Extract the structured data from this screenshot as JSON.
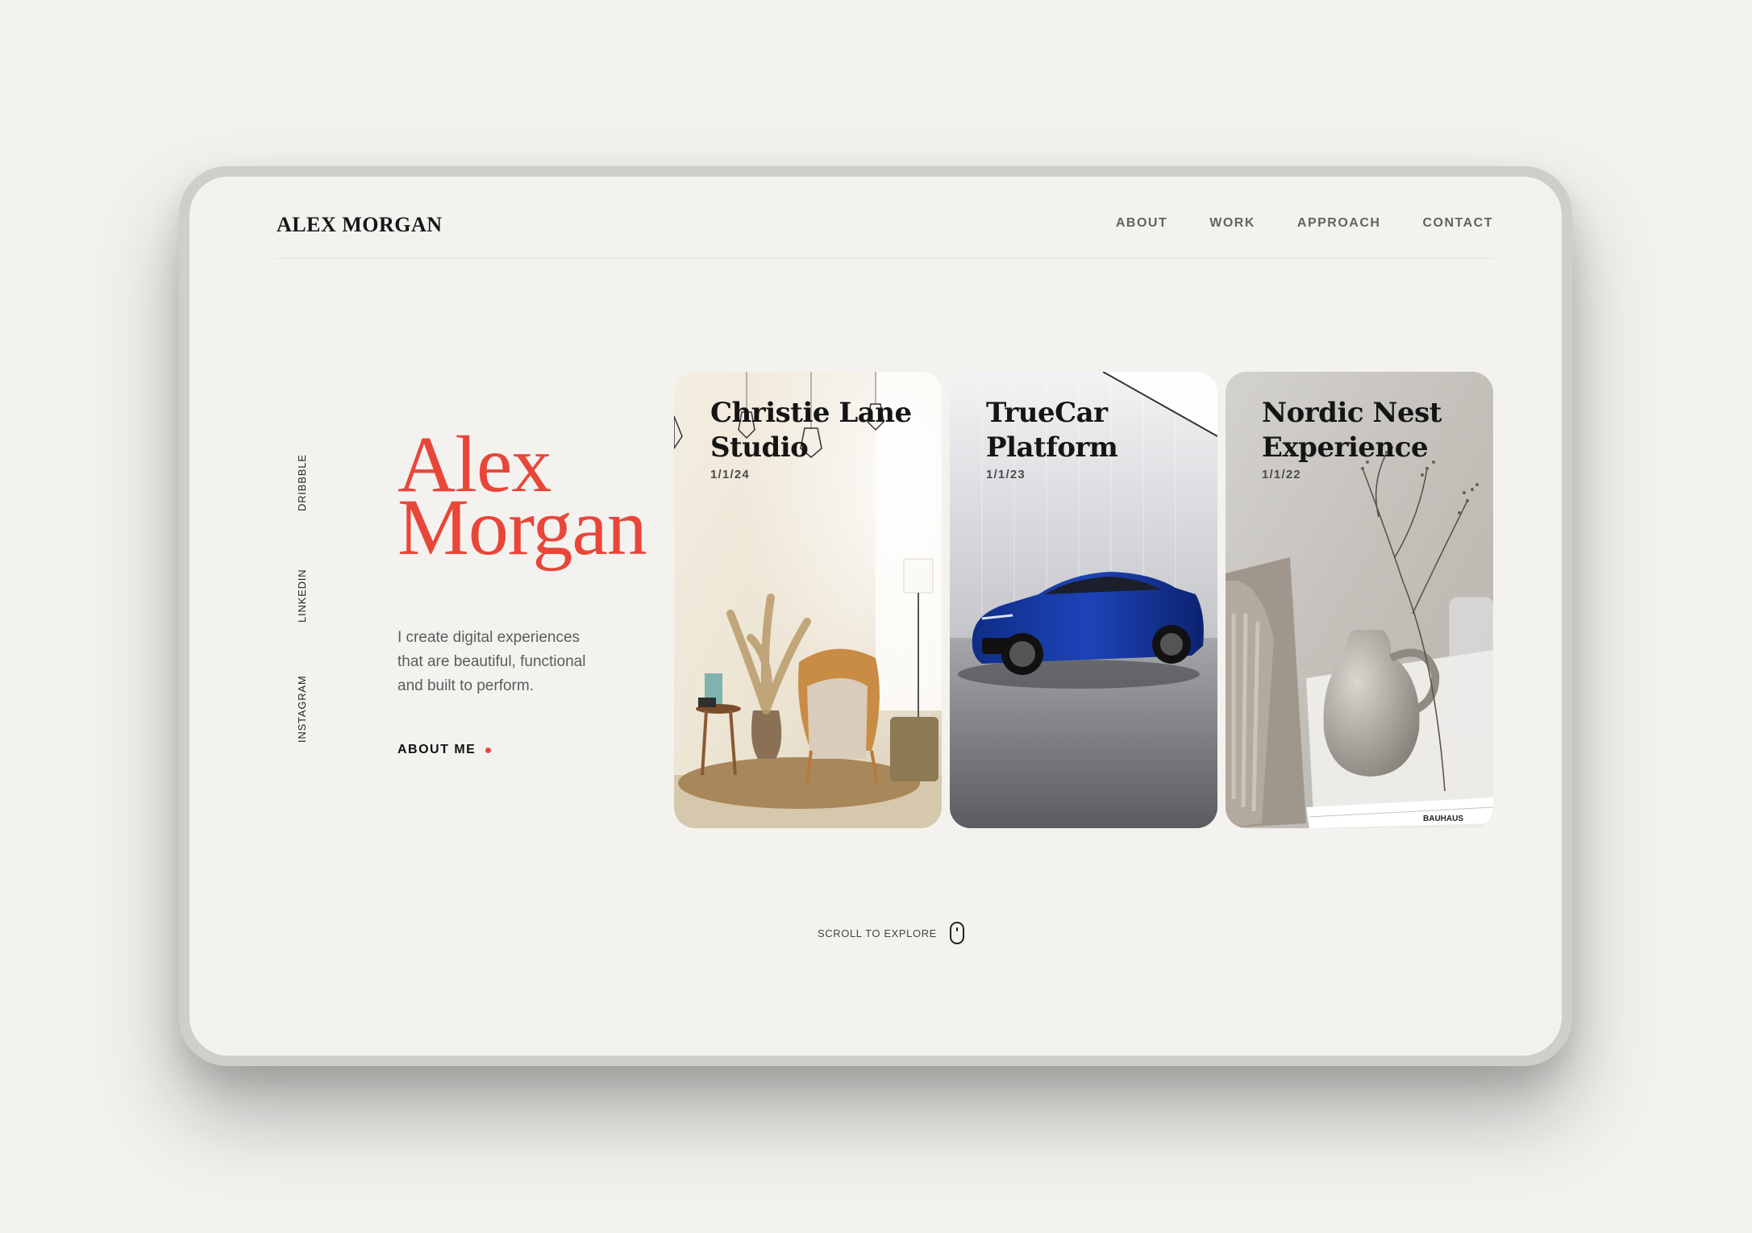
{
  "header": {
    "brand": "ALEX MORGAN",
    "nav": [
      "ABOUT",
      "WORK",
      "APPROACH",
      "CONTACT"
    ]
  },
  "social": [
    "DRIBBBLE",
    "LINKEDIN",
    "INSTAGRAM"
  ],
  "hero": {
    "name_line1": "Alex",
    "name_line2": "Morgan",
    "tagline": "I create digital experiences that are beautiful, functional and built to perform.",
    "cta": "ABOUT ME"
  },
  "projects": [
    {
      "title_line1": "Christie Lane",
      "title_line2": "Studio",
      "date": "1/1/24"
    },
    {
      "title_line1": "TrueCar",
      "title_line2": "Platform",
      "date": "1/1/23"
    },
    {
      "title_line1": "Nordic Nest",
      "title_line2": "Experience",
      "date": "1/1/22"
    }
  ],
  "book_labels": [
    "BAUHAUS"
  ],
  "scroll": "SCROLL TO EXPLORE",
  "colors": {
    "accent": "#e9463a",
    "background": "#f3f2ef",
    "text": "#151515"
  },
  "icons": {
    "scroll": "mouse-icon",
    "cta": "dot-icon"
  }
}
